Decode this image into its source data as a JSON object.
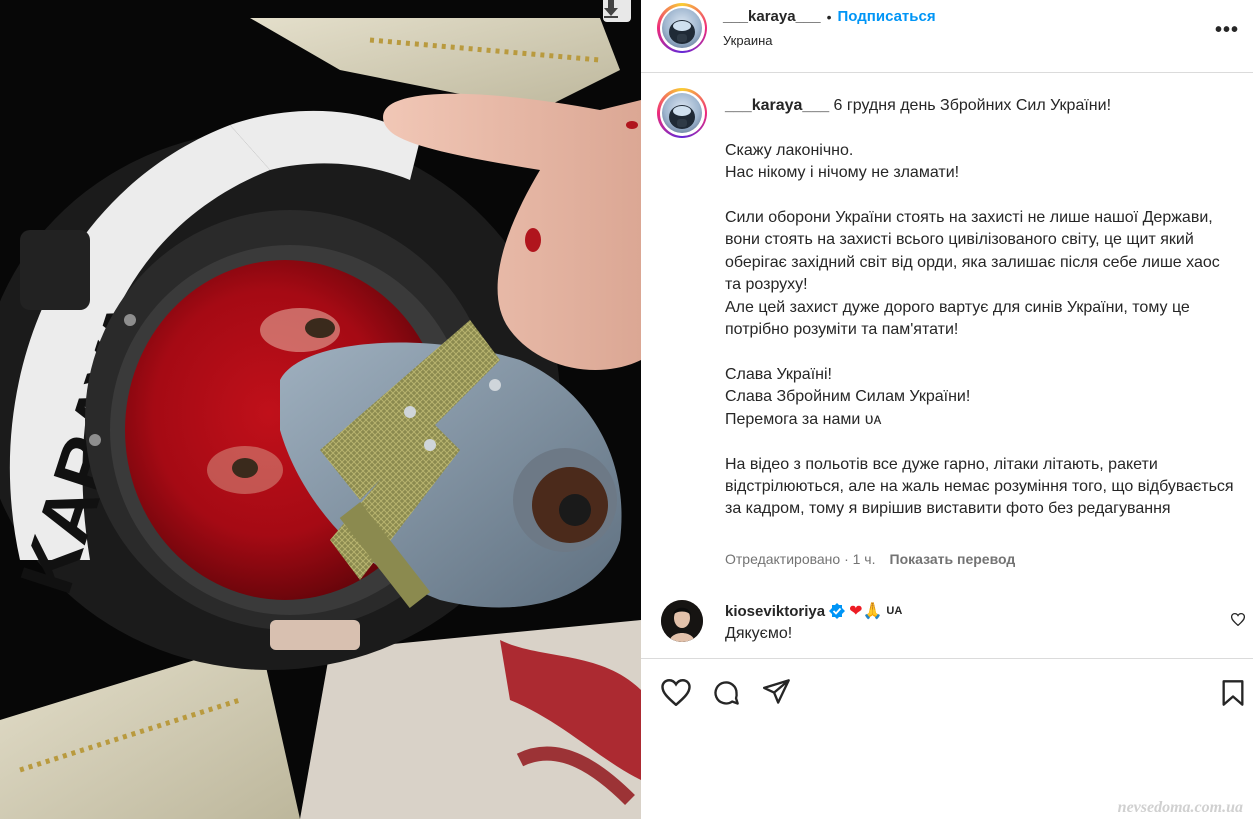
{
  "post": {
    "username": "___karaya___",
    "separator": "•",
    "follow_label": "Подписаться",
    "location": "Украина",
    "more_label": "•••",
    "caption_username": "___karaya___",
    "caption_body": " 6 грудня день Збройних Сил України!\n\nСкажу лаконічно.\nНас нікому і нічому не зламати!\n\nСили оборони України стоять на захисті не лише нашої Держави, вони стоять на захисті всього цивілізованого світу, це щит який оберігає західний світ від орди, яка залишає після себе лише хаос та розруху!\nАле цей захист дуже дорого вартує для синів України, тому це потрібно розуміти та пам'ятати!\n\nСлава Україні!\nСлава Збройним Силам України!\nПеремога за нами ᴜᴀ\n\nНа відео з польотів все дуже гарно, літаки літають, ракети відстрілюються, але на жаль немає розуміння того, що відбувається за кадром, тому я вирішив виставити фото без редагування",
    "edited_label": "Отредактировано · 1 ч.",
    "translate_label": "Показать перевод",
    "helmet_text": "KARAYA"
  },
  "comment": {
    "username": "kioseviktoriya",
    "emojis": "❤🙏",
    "flag_label": "UA",
    "text": "Дякуємо!"
  },
  "icons": {
    "like": "heart-icon",
    "comment": "comment-icon",
    "share": "share-icon",
    "save": "bookmark-icon",
    "verified": "verified-badge-icon",
    "download": "download-arrow-icon"
  },
  "colors": {
    "link_blue": "#0095f6",
    "verified_blue": "#0095f6",
    "heart_red": "#ed1c24",
    "text": "#262626",
    "muted": "#737373"
  },
  "watermark": "nevsedoma.com.ua"
}
